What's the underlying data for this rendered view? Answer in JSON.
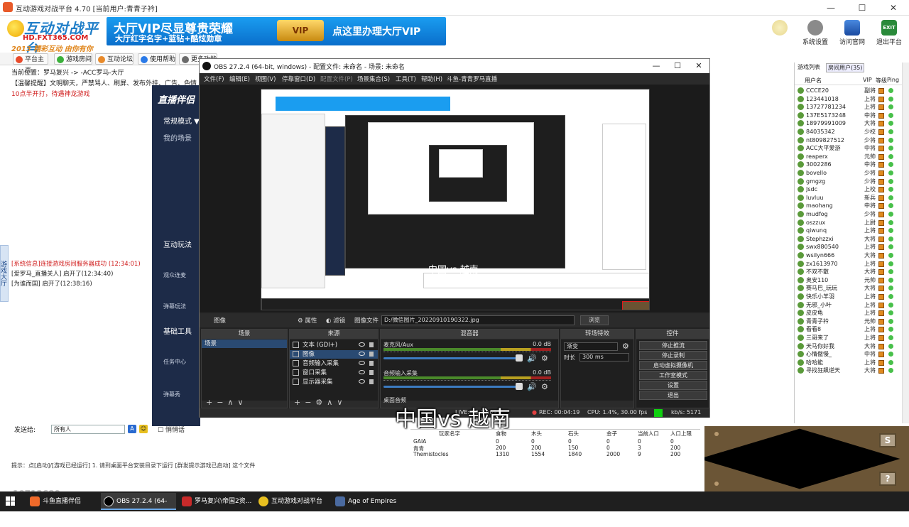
{
  "host": {
    "title": "互动游戏对战平台 4.70 [当前用户:青青子衿]",
    "brand": {
      "big": "互动对战平台",
      "url": "HD.FXT365.COM",
      "tag": "2013 精彩互动 由你有你"
    },
    "vip_banner": {
      "line1": "大厅VIP尽显尊贵荣耀",
      "line2": "大厅红字名字+蓝钻+酷炫勋章",
      "badge": "VIP",
      "right": "点这里办理大厅VIP"
    },
    "top_buttons": [
      {
        "label": ""
      },
      {
        "label": "系统设置"
      },
      {
        "label": "访问官网"
      },
      {
        "label": "退出平台"
      }
    ],
    "tabs": [
      "平台主页",
      "游戏房间",
      "互动论坛",
      "使用帮助",
      "更多功能"
    ],
    "left_text": [
      "当前位置：罗马复兴 -> -ACC罗马-大厅",
      "【温馨提醒】文明聊天，严禁骂人、刷屏、发布外挂、广告、色情...",
      "10点半开打，待遇神龙游戏"
    ],
    "live_app": {
      "logo": "直播伴侣",
      "mode": "常规模式 ▼",
      "scene": "我的场景",
      "sec1": "互动玩法",
      "item1": "观众连麦",
      "item2": "弹幕玩法",
      "sec2": "基础工具",
      "item3": "任务中心",
      "item4": "弹幕秀"
    },
    "chat": [
      "[系统信息]连接游戏房间服务器成功 (12:34:01)",
      "[爱罗马_直播关人] 启开了(12:34:40)",
      "[为谁而国] 启开了(12:38:16)"
    ],
    "chat_input": {
      "label": "发送给:",
      "target": "所有人",
      "btn_a": "A",
      "btn_b": "☺",
      "checkbox": "悄悄话"
    },
    "bottom_tip": "提示：点[启动]/[游戏已经运行] 1. 请到桌面平台安装目录下运行 [群发提示游戏已启动] 这个文件",
    "counter": "10713680",
    "vertical_tab": "游戏大厅"
  },
  "user_list": {
    "tabs": [
      "游戏列表",
      "房间用户(35)"
    ],
    "columns": [
      "用户名",
      "VIP",
      "等级",
      "Ping"
    ],
    "users": [
      {
        "name": "CCCE20",
        "rank": "副将"
      },
      {
        "name": "123441018",
        "rank": "上将"
      },
      {
        "name": "13727781234",
        "rank": "上将"
      },
      {
        "name": "137E5173248",
        "rank": "中将"
      },
      {
        "name": "18979991009",
        "rank": "大将"
      },
      {
        "name": "84035342",
        "rank": "少校"
      },
      {
        "name": "nt809827512",
        "rank": "少将"
      },
      {
        "name": "ACC大平爱游",
        "rank": "中将"
      },
      {
        "name": "reaperx",
        "rank": "元帅"
      },
      {
        "name": "3002286",
        "rank": "中将"
      },
      {
        "name": "bovello",
        "rank": "少将"
      },
      {
        "name": "gmgzg",
        "rank": "少将"
      },
      {
        "name": "Jsdc",
        "rank": "上校"
      },
      {
        "name": "luvluu",
        "rank": "新兵"
      },
      {
        "name": "maohang",
        "rank": "中将"
      },
      {
        "name": "mudfog",
        "rank": "少将"
      },
      {
        "name": "oszzux",
        "rank": "上尉"
      },
      {
        "name": "qiwunq",
        "rank": "上将"
      },
      {
        "name": "Stephzzxi",
        "rank": "大将"
      },
      {
        "name": "swx880540",
        "rank": "上将"
      },
      {
        "name": "wsilyn666",
        "rank": "大将"
      },
      {
        "name": "zx1613970",
        "rank": "上将"
      },
      {
        "name": "不双不散",
        "rank": "大将"
      },
      {
        "name": "奥安110",
        "rank": "元帅"
      },
      {
        "name": "赛马巴_玩玩",
        "rank": "大将"
      },
      {
        "name": "快乐小羊羽",
        "rank": "上将"
      },
      {
        "name": "无邪_小叶",
        "rank": "上将"
      },
      {
        "name": "皮皮龟",
        "rank": "上将"
      },
      {
        "name": "青青子衿",
        "rank": "元帅"
      },
      {
        "name": "看看8",
        "rank": "上将"
      },
      {
        "name": "三哥来了",
        "rank": "上将"
      },
      {
        "name": "天马你好我",
        "rank": "大将"
      },
      {
        "name": "心情傲慢_",
        "rank": "中将"
      },
      {
        "name": "哈哈能",
        "rank": "上将"
      },
      {
        "name": "寻找狂飙逆天",
        "rank": "大将"
      }
    ]
  },
  "obs": {
    "title": "OBS 27.2.4 (64-bit, windows) - 配置文件: 未命名 - 场景: 未命名",
    "menu": [
      "文件(F)",
      "编辑(E)",
      "视图(V)",
      "停靠窗口(D)",
      "配置文件(P)",
      "场景集合(S)",
      "工具(T)",
      "帮助(H)",
      "斗鱼-青青罗马直播"
    ],
    "overlay_text": "中国vs 越南",
    "source_bar": {
      "name": "图像",
      "props": "属性",
      "filters": "滤镜",
      "file_label": "图像文件",
      "path": "D:/微信图片_20220910190322.jpg",
      "browse": "浏览"
    },
    "scenes": {
      "header": "场景",
      "items": [
        "场景"
      ]
    },
    "sources": {
      "header": "来源",
      "items": [
        "文本 (GDI+)",
        "图像",
        "音频输入采集",
        "窗口采集",
        "显示器采集"
      ]
    },
    "mixer": {
      "header": "混音器",
      "channels": [
        {
          "name": "麦克风/Aux",
          "db": "0.0 dB"
        },
        {
          "name": "音频输入采集",
          "db": "0.0 dB"
        },
        {
          "name": "桌面音频",
          "db": ""
        }
      ]
    },
    "transitions": {
      "header": "转场特效",
      "type": "渐变",
      "duration_label": "时长",
      "duration": "300 ms"
    },
    "controls": {
      "header": "控件",
      "buttons": [
        "停止推流",
        "停止录制",
        "启动虚拟摄像机",
        "工作室模式",
        "设置",
        "退出"
      ]
    },
    "status": {
      "live": "LIVE: 00:00:09",
      "rec": "REC: 00:04:19",
      "cpu": "CPU: 1.4%, 30.00 fps",
      "kbps": "kb/s: 5171"
    }
  },
  "big_subtitle": "中国vs 越南",
  "game_table": {
    "headers": [
      "玩家名字",
      "食物",
      "木头",
      "石头",
      "金子",
      "当前人口",
      "人口上限"
    ],
    "rows": [
      [
        "GAIA",
        "0",
        "0",
        "0",
        "0",
        "0",
        "0"
      ],
      [
        "青青",
        "200",
        "200",
        "150",
        "0",
        "3",
        "200"
      ],
      [
        "Themistocles",
        "1310",
        "1554",
        "1840",
        "2000",
        "9",
        "200"
      ]
    ]
  },
  "game_img": {
    "btn_top": "S",
    "btn_bottom": "?"
  },
  "taskbar": {
    "items": [
      "斗鱼直播伴侣",
      "OBS 27.2.4 (64-bi...",
      "罗马复兴\\帝国2资...",
      "互动游戏对战平台 ...",
      "Age of Empires E..."
    ]
  },
  "colors": {
    "obs_bg": "#222222",
    "vip_blue": "#1a9df0",
    "taskbar": "#1f1f1f",
    "live_app": "#1d2b48"
  }
}
